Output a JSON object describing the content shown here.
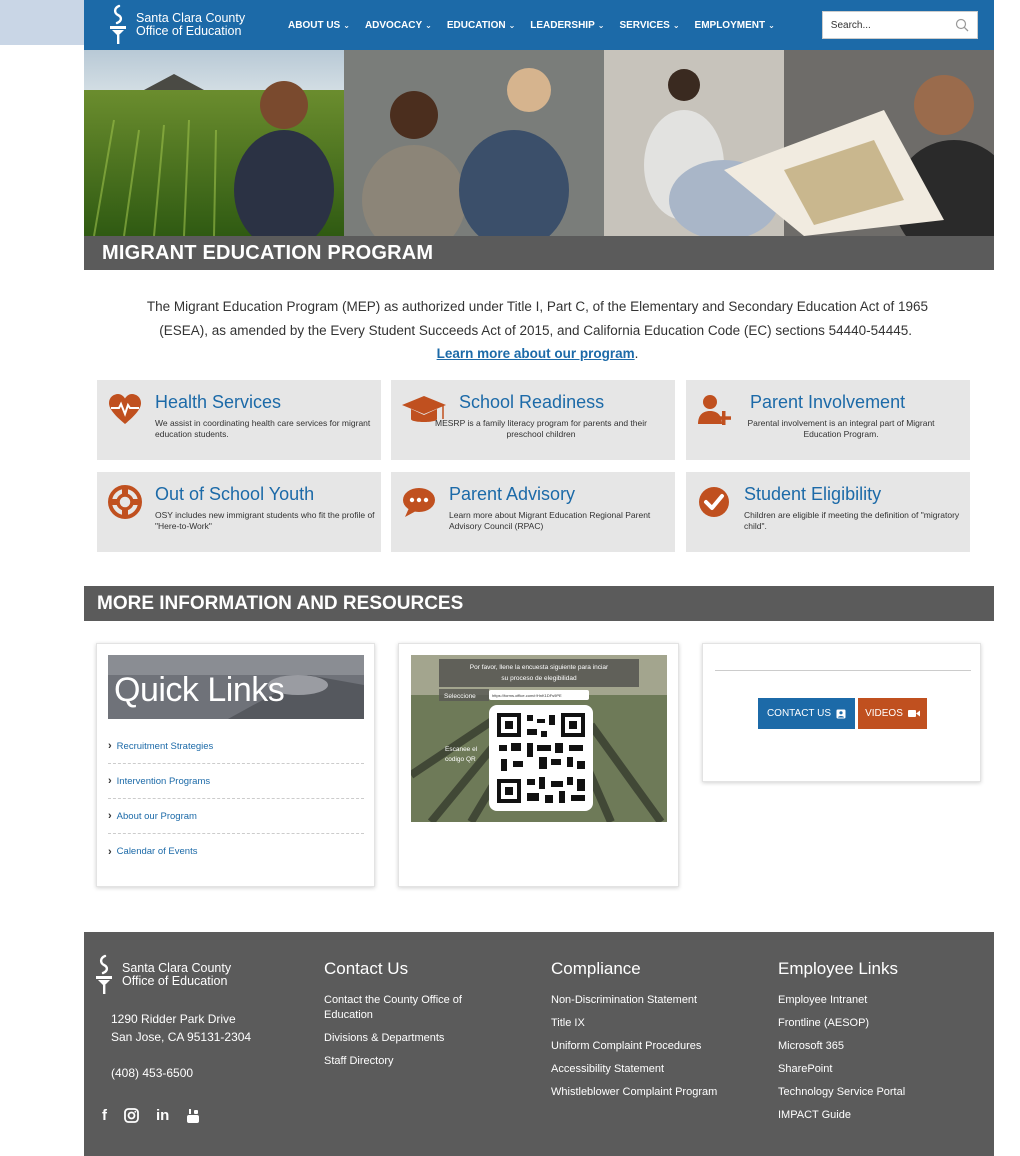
{
  "header": {
    "org_line1": "Santa Clara County",
    "org_line2": "Office of Education",
    "nav": [
      "ABOUT US",
      "ADVOCACY",
      "EDUCATION",
      "LEADERSHIP",
      "SERVICES",
      "EMPLOYMENT"
    ],
    "search_placeholder": "Search..."
  },
  "page": {
    "title": "MIGRANT EDUCATION PROGRAM",
    "intro": "The Migrant Education Program (MEP) as authorized under Title I, Part C, of the Elementary and Secondary Education Act of 1965 (ESEA), as amended by the Every Student Succeeds Act of 2015, and California Education Code (EC) sections 54440-54445.",
    "intro_link": "Learn more about our program",
    "intro_end": "."
  },
  "cards": [
    {
      "title": "Health Services",
      "desc": "We assist in coordinating health care services for migrant education students.",
      "icon": "heartbeat-icon"
    },
    {
      "title": "School Readiness",
      "desc": "MESRP is a family literacy program for parents and their preschool children",
      "icon": "graduation-cap-icon"
    },
    {
      "title": "Parent Involvement",
      "desc": "Parental involvement is an integral part of Migrant Education Program.",
      "icon": "add-user-icon"
    },
    {
      "title": "Out of School Youth",
      "desc": "OSY includes new immigrant students who fit the profile of \"Here-to-Work\"",
      "icon": "life-ring-icon"
    },
    {
      "title": "Parent Advisory",
      "desc": "Learn more about Migrant Education Regional Parent Advisory Council (RPAC)",
      "icon": "chat-bubble-icon"
    },
    {
      "title": "Student Eligibility",
      "desc": "Children are eligible if meeting the definition of \"migratory child\".",
      "icon": "check-circle-icon"
    }
  ],
  "resources": {
    "title": "MORE INFORMATION AND RESOURCES",
    "quick_links_title": "Quick Links",
    "quick_links": [
      "Recruitment Strategies",
      "Intervention Programs",
      "About our Program",
      "Calendar of Events"
    ],
    "qr": {
      "line1": "Por favor, llene la encuesta siguiente para inciar",
      "line2": "su proceso de elegibilidad",
      "select_label": "Seleccione",
      "url": "https://forms.office.com/r/HnK1DFs9PE",
      "scan_label1": "Escanee el",
      "scan_label2": "codigo QR"
    },
    "contact_button": "CONTACT US",
    "videos_button": "VIDEOS"
  },
  "footer": {
    "org_line1": "Santa Clara County",
    "org_line2": "Office of Education",
    "address1": "1290 Ridder Park Drive",
    "address2": "San Jose, CA 95131-2304",
    "phone": "(408) 453-6500",
    "contact_title": "Contact Us",
    "contact_links": [
      "Contact the County Office of Education",
      "Divisions & Departments",
      "Staff Directory"
    ],
    "compliance_title": "Compliance",
    "compliance_links": [
      "Non-Discrimination Statement",
      "Title IX",
      "Uniform Complaint Procedures",
      "Accessibility Statement",
      "Whistleblower Complaint Program"
    ],
    "employee_title": "Employee Links",
    "employee_links": [
      "Employee Intranet",
      "Frontline (AESOP)",
      "Microsoft 365",
      "SharePoint",
      "Technology Service Portal",
      "IMPACT Guide"
    ],
    "social": [
      "f",
      "in"
    ]
  },
  "colors": {
    "brand_blue": "#1c6aa8",
    "accent_orange": "#c0501f",
    "dark_gray": "#5b5b5b",
    "card_gray": "#e6e6e6"
  }
}
